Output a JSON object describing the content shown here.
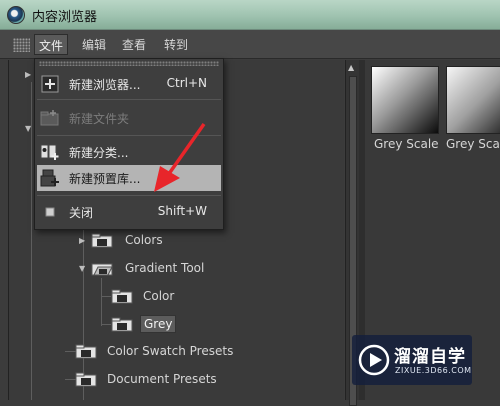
{
  "window": {
    "title": "内容浏览器"
  },
  "menubar": {
    "items": [
      {
        "label": "文件",
        "active": true
      },
      {
        "label": "编辑",
        "active": false
      },
      {
        "label": "查看",
        "active": false
      },
      {
        "label": "转到",
        "active": false
      }
    ]
  },
  "file_menu": {
    "items": [
      {
        "label": "新建浏览器...",
        "shortcut": "Ctrl+N",
        "icon": "new-browser-icon",
        "state": "normal"
      },
      {
        "label": "新建文件夹",
        "shortcut": "",
        "icon": "new-folder-icon",
        "state": "disabled"
      },
      {
        "label": "新建分类...",
        "shortcut": "",
        "icon": "new-category-icon",
        "state": "normal"
      },
      {
        "label": "新建预置库...",
        "shortcut": "",
        "icon": "new-preset-library-icon",
        "state": "highlighted"
      },
      {
        "label": "关闭",
        "shortcut": "Shift+W",
        "icon": "close-icon",
        "state": "normal"
      }
    ]
  },
  "tree": {
    "nodes": [
      {
        "label": "Colors",
        "icon": "folder-icon",
        "expander": "collapsed"
      },
      {
        "label": "Gradient Tool",
        "icon": "folder-open-icon",
        "expander": "expanded"
      },
      {
        "label": "Color",
        "icon": "folder-icon",
        "expander": ""
      },
      {
        "label": "Grey",
        "icon": "folder-icon",
        "expander": "",
        "selected": true
      },
      {
        "label": "Color Swatch Presets",
        "icon": "folder-icon",
        "expander": ""
      },
      {
        "label": "Document Presets",
        "icon": "folder-icon",
        "expander": ""
      }
    ]
  },
  "content": {
    "items": [
      {
        "label": "Grey Scale",
        "thumbnail": "grey-gradient"
      },
      {
        "label": "Grey Scal",
        "thumbnail": "grey-gradient"
      }
    ]
  },
  "watermark": {
    "title": "溜溜自学",
    "subtitle": "ZIXUE.3D66.COM"
  },
  "colors": {
    "highlight": "#b4b4b4",
    "arrow": "#e8252a",
    "panel": "#3a3a3a"
  }
}
